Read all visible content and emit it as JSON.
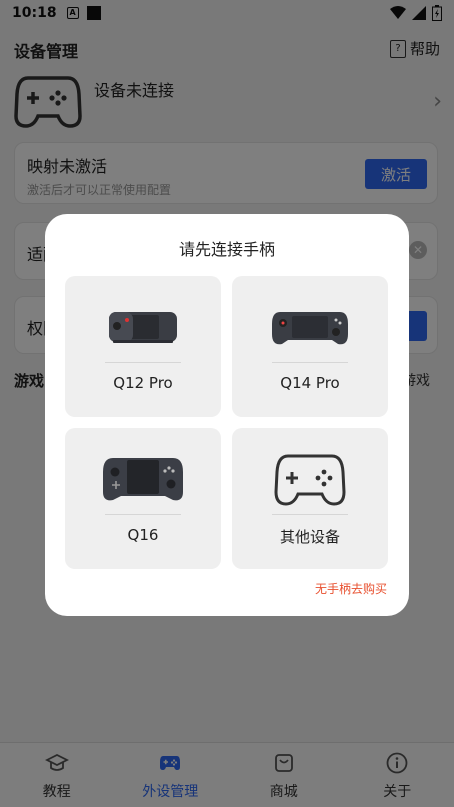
{
  "status_bar": {
    "time": "10:18",
    "icons": [
      "a-icon",
      "square-icon",
      "wifi-icon",
      "signal-icon",
      "battery-icon"
    ]
  },
  "header": {
    "title": "设备管理",
    "help_label": "帮助"
  },
  "device": {
    "status": "设备未连接"
  },
  "mapping_card": {
    "title": "映射未激活",
    "subtitle": "激活后才可以正常使用配置",
    "activate_label": "激活"
  },
  "adapt_card": {
    "title_partial": "适配"
  },
  "permission_card": {
    "title_partial": "权限"
  },
  "games": {
    "title_partial": "游戏",
    "right_partial": "游戏"
  },
  "dialog": {
    "title": "请先连接手柄",
    "options": [
      {
        "label": "Q12 Pro"
      },
      {
        "label": "Q14 Pro"
      },
      {
        "label": "Q16"
      },
      {
        "label": "其他设备"
      }
    ],
    "buy_link": "无手柄去购买"
  },
  "bottom_nav": {
    "items": [
      {
        "label": "教程",
        "icon": "graduation-cap-icon"
      },
      {
        "label": "外设管理",
        "icon": "gamepad-icon",
        "active": true
      },
      {
        "label": "商城",
        "icon": "shopping-bag-icon"
      },
      {
        "label": "关于",
        "icon": "info-icon"
      }
    ]
  },
  "colors": {
    "accent": "#2e69f2",
    "link_red": "#e8502f",
    "overlay": "rgba(0,0,0,0.5)"
  }
}
